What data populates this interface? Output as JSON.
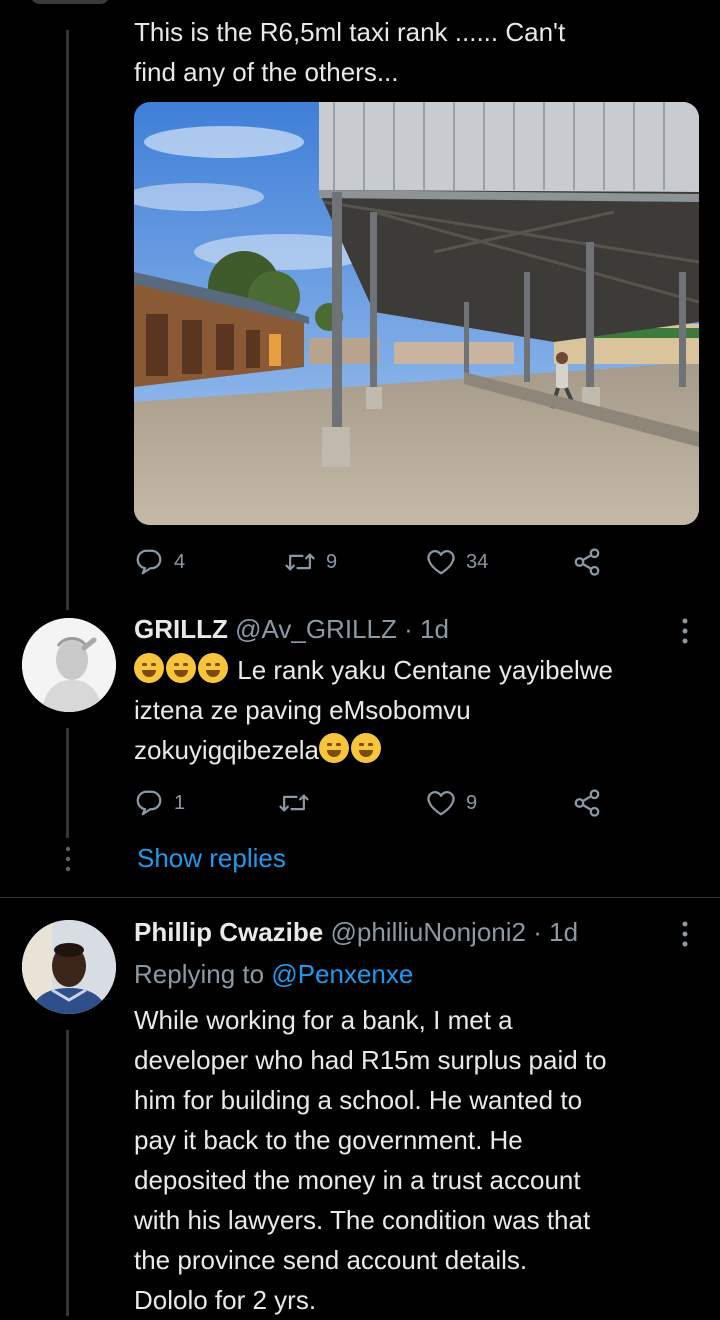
{
  "tweet1": {
    "text_line1": "This is the R6,5ml taxi rank ...... Can't",
    "text_line2": "find any of the others...",
    "photo_alt": "taxi rank",
    "replies": "4",
    "retweets": "9",
    "likes": "34"
  },
  "tweet2": {
    "name": "GRILLZ",
    "handle": "@Av_GRILLZ",
    "dot": "·",
    "time": "1d",
    "text_line1": "Le rank yaku Centane yayibelwe",
    "text_line2": "iztena ze paving eMsobomvu",
    "text_line3": "zokuyigqibezela",
    "replies": "1",
    "retweets": "",
    "likes": "9",
    "show_replies": "Show replies"
  },
  "tweet3": {
    "name": "Phillip Cwazibe",
    "handle": "@philliuNonjoni2",
    "dot": "·",
    "time": "1d",
    "replying_prefix": "Replying to",
    "replying_handle": "@Penxenxe",
    "lines": [
      "While working for a bank, I met a",
      "developer who had R15m surplus paid to",
      "him for building a school. He wanted to",
      "pay it back to the government. He",
      "deposited the money in a trust account",
      "with his lawyers. The condition was that",
      "the province send account details.",
      "Dololo for 2 yrs."
    ]
  },
  "icons": {
    "reply": "reply-icon",
    "retweet": "retweet-icon",
    "like": "heart-icon",
    "share": "share-icon",
    "more": "more-vertical-icon"
  },
  "colors": {
    "background": "#000000",
    "text": "#e7e9ea",
    "muted": "#8b98a5",
    "link": "#1d9bf0",
    "divider": "#2f3336"
  }
}
